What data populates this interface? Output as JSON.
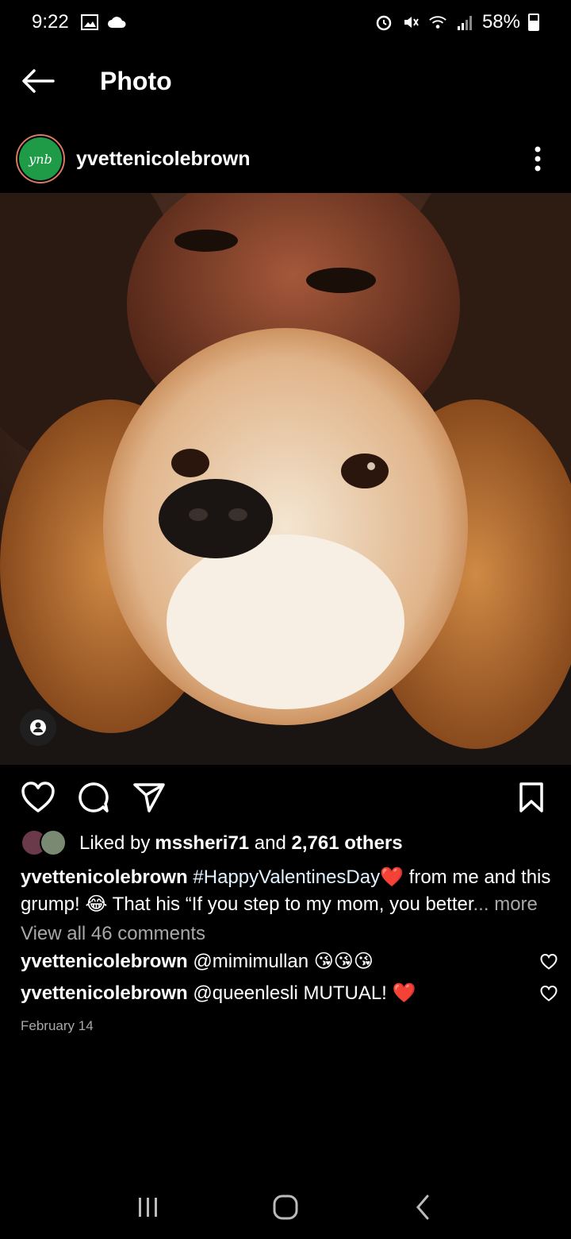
{
  "status_bar": {
    "time": "9:22",
    "battery": "58%",
    "left_icons": [
      "image-icon",
      "cloud-icon"
    ],
    "right_icons": [
      "alarm-icon",
      "mute-icon",
      "wifi-icon",
      "signal-icon",
      "battery-icon"
    ]
  },
  "header": {
    "title": "Photo",
    "back_icon": "arrow-left-icon"
  },
  "post": {
    "username": "yvettenicolebrown",
    "avatar_text": "ynb",
    "more_icon": "vertical-ellipsis-icon",
    "photo_alt": "Woman with curly hair hugging a cocker spaniel dog",
    "likes": {
      "prefix": "Liked by ",
      "user": "mssheri71",
      "middle": " and ",
      "count": "2,761 others"
    },
    "caption": {
      "username": "yvettenicolebrown",
      "hashtag": "#HappyValentinesDay",
      "emoji_heart": "❤️",
      "text_1": " from me and this grump! ",
      "emoji_laugh": "😂",
      "text_2": " That his “If you step to my mom, you better",
      "ellipsis": "...",
      "more": " more"
    },
    "view_comments": "View all 46 comments",
    "comments": [
      {
        "username": "yvettenicolebrown",
        "text": "@mimimullan",
        "emoji": "😘😘😘"
      },
      {
        "username": "yvettenicolebrown",
        "text": "@queenlesli MUTUAL!",
        "emoji": "❤️"
      }
    ],
    "date": "February 14"
  },
  "colors": {
    "background": "#000000",
    "text": "#ffffff",
    "muted": "#a8a8a8",
    "avatar_green": "#1f9a47"
  }
}
